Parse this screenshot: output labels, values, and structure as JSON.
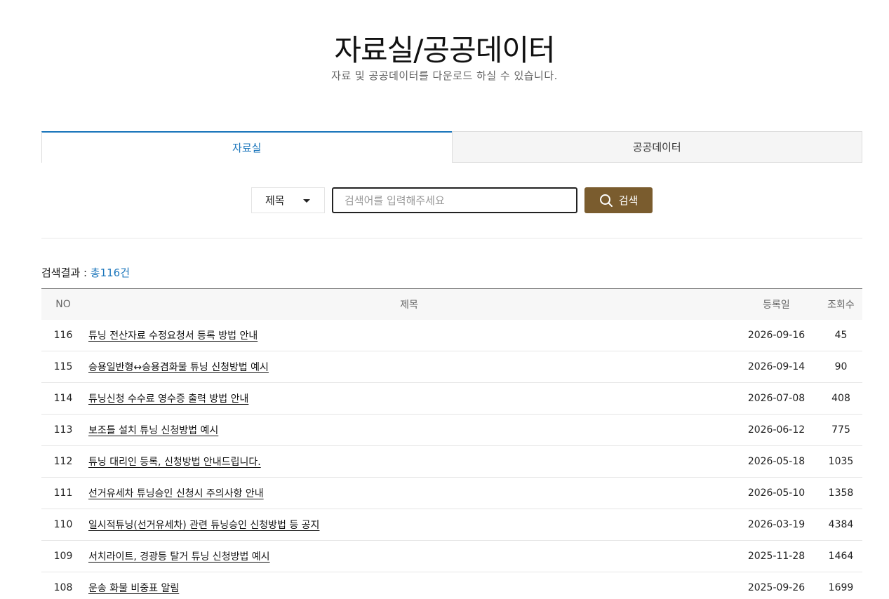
{
  "header": {
    "title": "자료실/공공데이터",
    "subtitle": "자료 및 공공데이터를 다운로드 하실 수 있습니다."
  },
  "tabs": [
    {
      "label": "자료실",
      "active": true
    },
    {
      "label": "공공데이터",
      "active": false
    }
  ],
  "search": {
    "select_value": "제목",
    "placeholder": "검색어를 입력해주세요",
    "button_label": "검색"
  },
  "result": {
    "prefix": "검색결과 : ",
    "count_text": "총116건"
  },
  "table": {
    "headers": {
      "no": "NO",
      "title": "제목",
      "date": "등록일",
      "views": "조회수"
    },
    "rows": [
      {
        "no": "116",
        "title": "튜닝 전산자료 수정요청서 등록 방법 안내",
        "date": "2026-09-16",
        "views": "45"
      },
      {
        "no": "115",
        "title": "승용일반형↔승용겸화물 튜닝 신청방법 예시",
        "date": "2026-09-14",
        "views": "90"
      },
      {
        "no": "114",
        "title": "튜닝신청 수수료 영수증 출력 방법 안내",
        "date": "2026-07-08",
        "views": "408"
      },
      {
        "no": "113",
        "title": "보조틀 설치 튜닝 신청방법 예시",
        "date": "2026-06-12",
        "views": "775"
      },
      {
        "no": "112",
        "title": "튜닝 대리인 등록, 신청방법 안내드립니다.",
        "date": "2026-05-18",
        "views": "1035"
      },
      {
        "no": "111",
        "title": "선거유세차 튜닝승인 신청시 주의사항 안내",
        "date": "2026-05-10",
        "views": "1358"
      },
      {
        "no": "110",
        "title": "일시적튜닝(선거유세차) 관련 튜닝승인 신청방법 등 공지",
        "date": "2026-03-19",
        "views": "4384"
      },
      {
        "no": "109",
        "title": "서치라이트, 경광등 탈거 튜닝 신청방법 예시",
        "date": "2025-11-28",
        "views": "1464"
      },
      {
        "no": "108",
        "title": "운송 화물 비중표 알림",
        "date": "2025-09-26",
        "views": "1699"
      }
    ]
  },
  "colors": {
    "accent": "#1a75bb",
    "search_button": "#7a5c2e"
  },
  "icons": {
    "select": "chevron-down-icon",
    "search": "search-icon"
  }
}
